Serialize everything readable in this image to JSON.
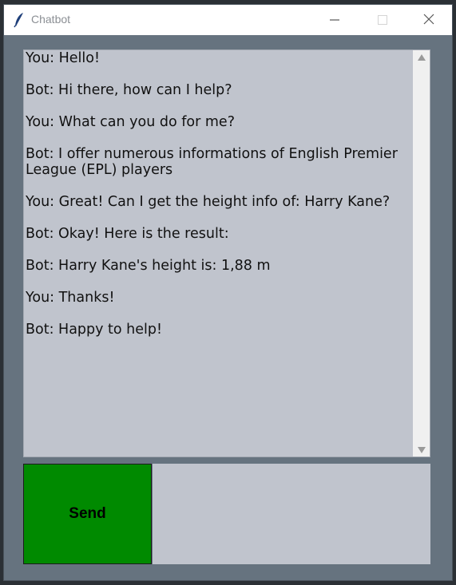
{
  "window": {
    "title": "Chatbot",
    "icon": "feather-icon",
    "controls": [
      "minimize-icon",
      "maximize-icon",
      "close-icon"
    ]
  },
  "chat": {
    "messages": [
      "You: Hello!",
      "Bot: Hi there, how can I help?",
      "You: What can you do for me?",
      "Bot: I offer numerous informations of English Premier League (EPL) players",
      "You: Great! Can I get the height info of: Harry Kane?",
      "Bot: Okay! Here is the result:",
      "Bot: Harry Kane's height is: 1,88 m",
      "You: Thanks!",
      "Bot: Happy to help!"
    ]
  },
  "composer": {
    "send_label": "Send",
    "input_value": ""
  },
  "colors": {
    "window_bg": "#66737f",
    "chat_bg": "#c0c4cd",
    "send_bg": "#008a00"
  }
}
